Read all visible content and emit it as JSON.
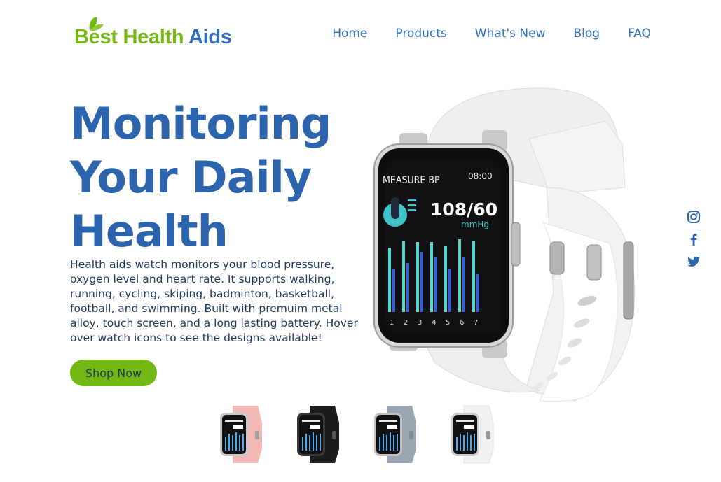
{
  "brand": {
    "word1": "Best",
    "word2": "Health",
    "word3": "Aids"
  },
  "nav": {
    "home": "Home",
    "products": "Products",
    "whats_new": "What's New",
    "blog": "Blog",
    "faq": "FAQ"
  },
  "hero": {
    "title_line1": "Monitoring",
    "title_line2": "Your Daily",
    "title_line3": "Health",
    "description": "Health aids watch monitors your blood pressure, oxygen level and heart rate. It supports walking, running, cycling, skiping, badminton, basketball, football, and swimming. Built with premuim metal alloy, touch screen, and a long lasting battery. Hover over watch icons to see the designs available!",
    "cta": "Shop Now"
  },
  "watch_screen": {
    "mode": "MEASURE BP",
    "time": "08:00",
    "reading": "108/60",
    "unit": "mmHg",
    "days": [
      "1",
      "2",
      "3",
      "4",
      "5",
      "6",
      "7"
    ]
  },
  "social": {
    "icons": [
      "instagram-icon",
      "facebook-icon",
      "twitter-icon"
    ]
  },
  "thumbnails": [
    {
      "name": "pink-watch",
      "strap": "#f2b8b5"
    },
    {
      "name": "black-watch",
      "strap": "#1c1c1e"
    },
    {
      "name": "grey-watch",
      "strap": "#9aa7b3"
    },
    {
      "name": "white-watch",
      "strap": "#f1f1f1"
    }
  ],
  "colors": {
    "brand_green": "#74b816",
    "brand_blue": "#2c64ae",
    "text": "#1f3a5c"
  }
}
